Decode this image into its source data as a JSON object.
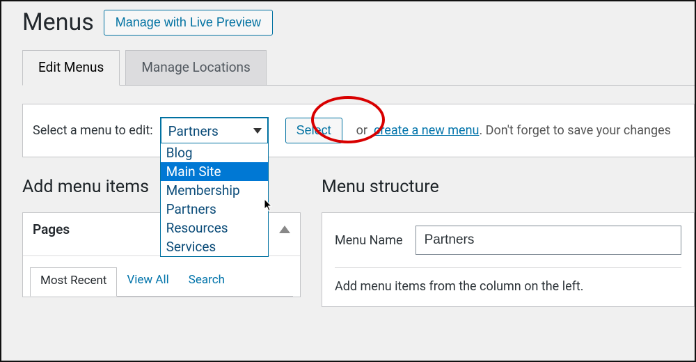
{
  "header": {
    "page_title": "Menus",
    "live_preview_label": "Manage with Live Preview"
  },
  "tabs": {
    "edit": "Edit Menus",
    "locations": "Manage Locations"
  },
  "menu_select": {
    "label": "Select a menu to edit:",
    "selected": "Partners",
    "options": [
      "Blog",
      "Main Site",
      "Membership",
      "Partners",
      "Resources",
      "Services"
    ],
    "highlighted_index": 1,
    "select_button": "Select",
    "or_text": "or",
    "create_link": "create a new menu",
    "dont_forget": ". Don't forget to save your changes"
  },
  "left_col": {
    "heading": "Add menu items",
    "accordion_title": "Pages",
    "inner_tabs": [
      "Most Recent",
      "View All",
      "Search"
    ]
  },
  "right_col": {
    "heading": "Menu structure",
    "menu_name_label": "Menu Name",
    "menu_name_value": "Partners",
    "help": "Add menu items from the column on the left."
  },
  "colors": {
    "accent": "#0071a1",
    "highlight": "#0078d4",
    "annotation": "#d80000"
  }
}
